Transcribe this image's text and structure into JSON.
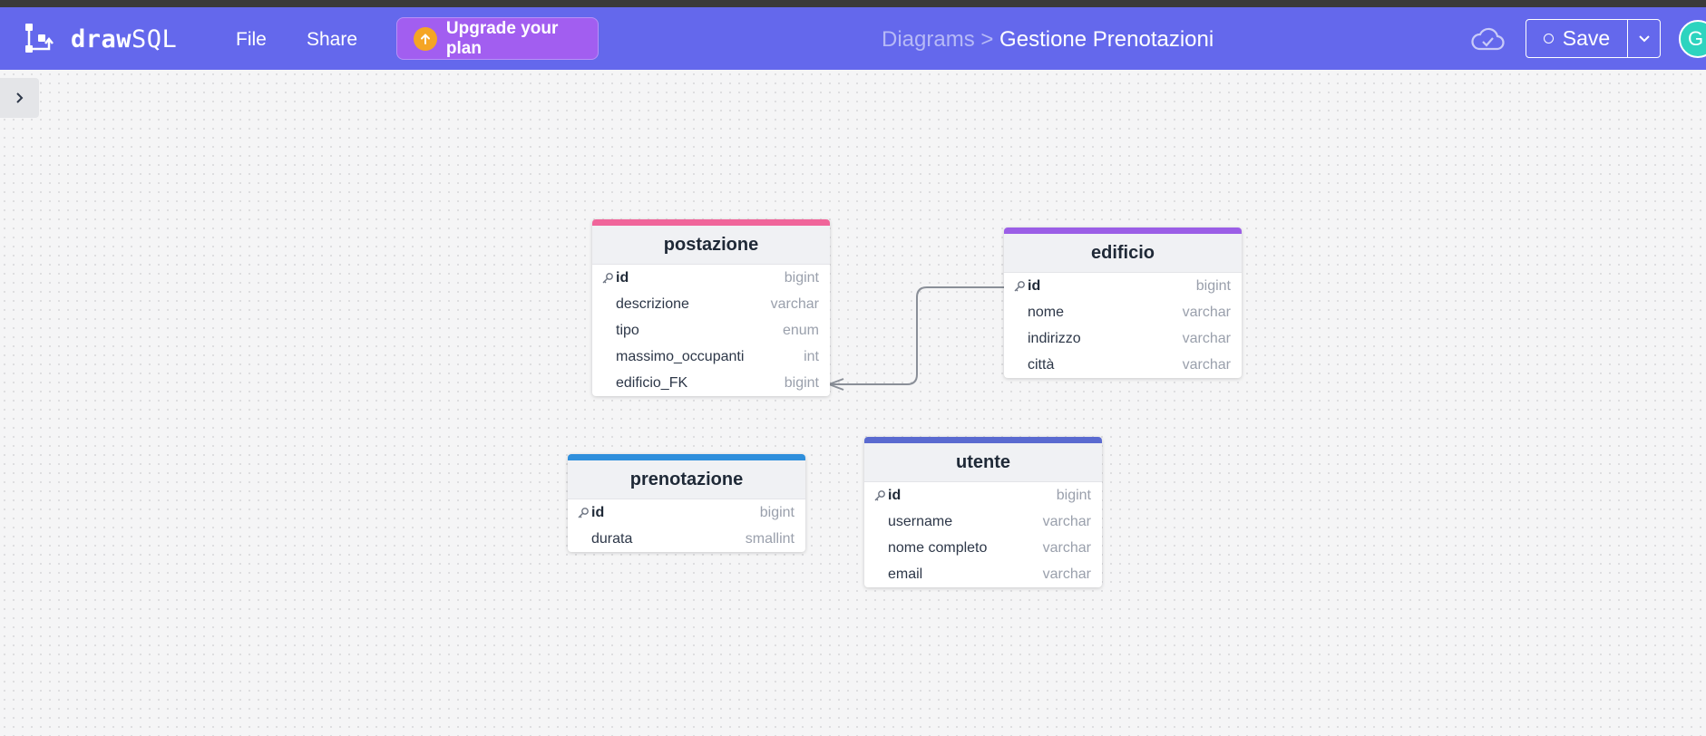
{
  "app": {
    "name_bold": "draw",
    "name_light": "SQL"
  },
  "nav": {
    "file": "File",
    "share": "Share",
    "upgrade": "Upgrade your plan"
  },
  "breadcrumb": {
    "parent": "Diagrams >",
    "current": "Gestione Prenotazioni"
  },
  "toolbar": {
    "save": "Save"
  },
  "user": {
    "avatar_initial": "G"
  },
  "colors": {
    "header": "#6468ec",
    "postazione": "#f0659a",
    "edificio": "#9b5ee6",
    "prenotazione": "#2f8fdc",
    "utente": "#5a6ad0"
  },
  "tables": {
    "postazione": {
      "name": "postazione",
      "columns": [
        {
          "name": "id",
          "type": "bigint",
          "pk": true
        },
        {
          "name": "descrizione",
          "type": "varchar"
        },
        {
          "name": "tipo",
          "type": "enum"
        },
        {
          "name": "massimo_occupanti",
          "type": "int"
        },
        {
          "name": "edificio_FK",
          "type": "bigint"
        }
      ]
    },
    "edificio": {
      "name": "edificio",
      "columns": [
        {
          "name": "id",
          "type": "bigint",
          "pk": true
        },
        {
          "name": "nome",
          "type": "varchar"
        },
        {
          "name": "indirizzo",
          "type": "varchar"
        },
        {
          "name": "città",
          "type": "varchar"
        }
      ]
    },
    "prenotazione": {
      "name": "prenotazione",
      "columns": [
        {
          "name": "id",
          "type": "bigint",
          "pk": true
        },
        {
          "name": "durata",
          "type": "smallint"
        }
      ]
    },
    "utente": {
      "name": "utente",
      "columns": [
        {
          "name": "id",
          "type": "bigint",
          "pk": true
        },
        {
          "name": "username",
          "type": "varchar"
        },
        {
          "name": "nome completo",
          "type": "varchar"
        },
        {
          "name": "email",
          "type": "varchar"
        }
      ]
    }
  }
}
